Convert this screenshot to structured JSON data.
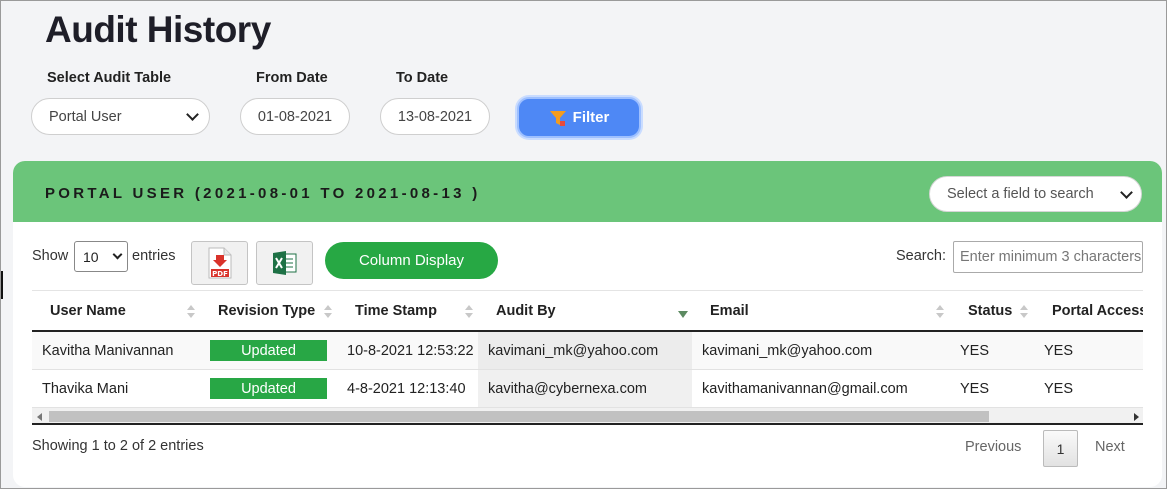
{
  "page": {
    "title": "Audit History"
  },
  "filters": {
    "table_label": "Select Audit Table",
    "table_value": "Portal User",
    "from_label": "From Date",
    "from_value": "01-08-2021",
    "to_label": "To Date",
    "to_value": "13-08-2021",
    "filter_button": "Filter"
  },
  "card": {
    "title": "PORTAL USER (2021-08-01 TO 2021-08-13 )",
    "field_search_placeholder": "Select a field to search"
  },
  "controls": {
    "show_label": "Show",
    "page_length": "10",
    "entries_label": "entries",
    "pdf_icon": "pdf-export-icon",
    "excel_icon": "excel-export-icon",
    "column_display": "Column Display",
    "search_label": "Search:",
    "search_placeholder": "Enter minimum 3 characters"
  },
  "table": {
    "columns": [
      "User Name",
      "Revision Type",
      "Time Stamp",
      "Audit By",
      "Email",
      "Status",
      "Portal Access"
    ],
    "rows": [
      {
        "user_name": "Kavitha Manivannan",
        "revision_type": "Updated",
        "time_stamp": "10-8-2021 12:53:22",
        "audit_by": "kavimani_mk@yahoo.com",
        "email": "kavimani_mk@yahoo.com",
        "status": "YES",
        "portal_access": "YES"
      },
      {
        "user_name": "Thavika Mani",
        "revision_type": "Updated",
        "time_stamp": "4-8-2021 12:13:40",
        "audit_by": "kavitha@cybernexa.com",
        "email": "kavithamanivannan@gmail.com",
        "status": "YES",
        "portal_access": "YES"
      }
    ]
  },
  "footer": {
    "info": "Showing 1 to 2 of 2 entries",
    "previous": "Previous",
    "current_page": "1",
    "next": "Next"
  },
  "colors": {
    "header_green": "#6bc57a",
    "badge_green": "#28a745",
    "filter_blue": "#4e88f5"
  }
}
